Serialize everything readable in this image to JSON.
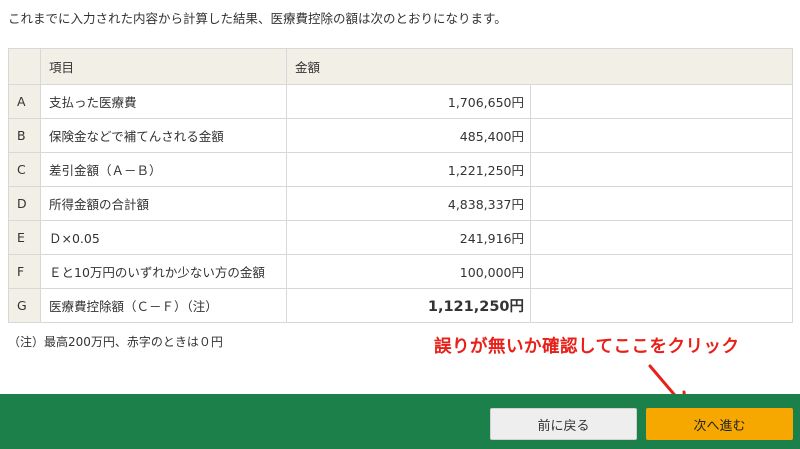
{
  "intro_text": "これまでに入力された内容から計算した結果、医療費控除の額は次のとおりになります。",
  "table": {
    "headers": {
      "item": "項目",
      "amount": "金額"
    },
    "rows": [
      {
        "key": "A",
        "item": "支払った医療費",
        "amount": "1,706,650円"
      },
      {
        "key": "B",
        "item": "保険金などで補てんされる金額",
        "amount": "485,400円"
      },
      {
        "key": "C",
        "item": "差引金額（Ａ－Ｂ）",
        "amount": "1,221,250円"
      },
      {
        "key": "D",
        "item": "所得金額の合計額",
        "amount": "4,838,337円"
      },
      {
        "key": "E",
        "item": "Ｄ×0.05",
        "amount": "241,916円"
      },
      {
        "key": "F",
        "item": "Ｅと10万円のいずれか少ない方の金額",
        "amount": "100,000円"
      },
      {
        "key": "G",
        "item": "医療費控除額（Ｃ－Ｆ）（注）",
        "amount": "1,121,250円"
      }
    ]
  },
  "note": "（注）最高200万円、赤字のときは０円",
  "callout": "誤りが無いか確認してここをクリック",
  "buttons": {
    "back": "前に戻る",
    "next": "次へ進む"
  },
  "colors": {
    "footer": "#1b8049",
    "next_button": "#f7a800",
    "callout": "#e8201a",
    "header_bg": "#f1efe6"
  }
}
